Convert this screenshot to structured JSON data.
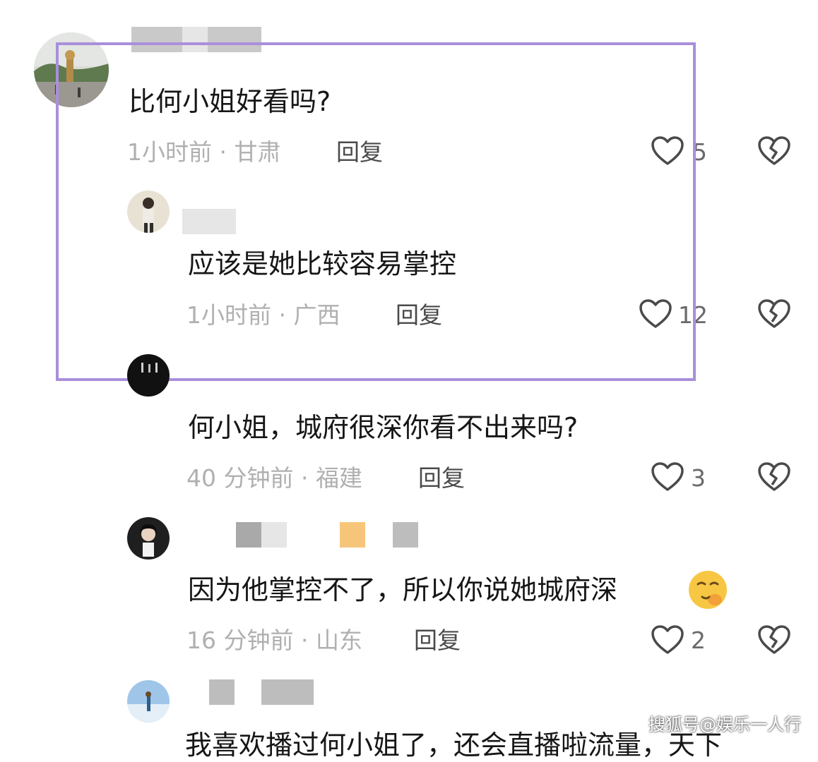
{
  "comments": [
    {
      "text": "比何小姐好看吗?",
      "meta": "1小时前 · 甘肃",
      "reply_label": "回复",
      "likes": "5"
    },
    {
      "text": "应该是她比较容易掌控",
      "meta": "1小时前 · 广西",
      "reply_label": "回复",
      "likes": "12"
    },
    {
      "text": "何小姐，城府很深你看不出来吗?",
      "meta": "40 分钟前 · 福建",
      "reply_label": "回复",
      "likes": "3"
    },
    {
      "text": "因为他掌控不了，所以你说她城府深",
      "meta": "16 分钟前 · 山东",
      "reply_label": "回复",
      "likes": "2"
    },
    {
      "text": "我喜欢播过何小姐了，还会直播啦流量，天下"
    }
  ],
  "watermark": "搜狐号@娱乐一人行",
  "colors": {
    "highlight_border": "#a98fdc",
    "meta_text": "#b0b0b0",
    "blur_orange": "#f7c57a"
  },
  "icons": {
    "like": "heart-outline-icon",
    "dislike": "broken-heart-icon",
    "emoji": "shushing-face-emoji-icon"
  }
}
